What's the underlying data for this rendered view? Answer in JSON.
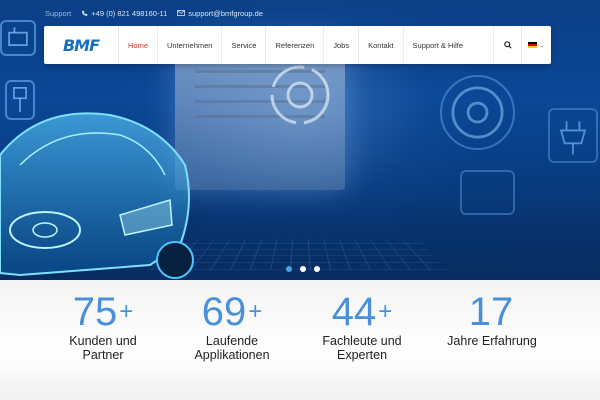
{
  "topbar": {
    "support_label": "Support",
    "phone": "+49 (0) 821 498160-11",
    "email": "support@bmfgroup.de"
  },
  "navbar": {
    "logo": "BMF",
    "items": [
      {
        "label": "Home",
        "active": true
      },
      {
        "label": "Unternehmen",
        "active": false
      },
      {
        "label": "Service",
        "active": false
      },
      {
        "label": "Referenzen",
        "active": false
      },
      {
        "label": "Jobs",
        "active": false
      },
      {
        "label": "Kontakt",
        "active": false
      },
      {
        "label": "Support & Hilfe",
        "active": false
      }
    ],
    "search_icon": "search-icon",
    "language_flag": "germany-flag"
  },
  "slider": {
    "slide_count": 3,
    "active_slide": 1
  },
  "stats": [
    {
      "number": "75",
      "plus": "+",
      "line1": "Kunden und",
      "line2": "Partner"
    },
    {
      "number": "69",
      "plus": "+",
      "line1": "Laufende",
      "line2": "Applikationen"
    },
    {
      "number": "44",
      "plus": "+",
      "line1": "Fachleute und",
      "line2": "Experten"
    },
    {
      "number": "17",
      "plus": "",
      "line1": "Jahre Erfahrung",
      "line2": ""
    }
  ],
  "colors": {
    "accent_red": "#d9352b",
    "stat_blue": "#4a90d9",
    "hero_blue": "#0a4796"
  }
}
